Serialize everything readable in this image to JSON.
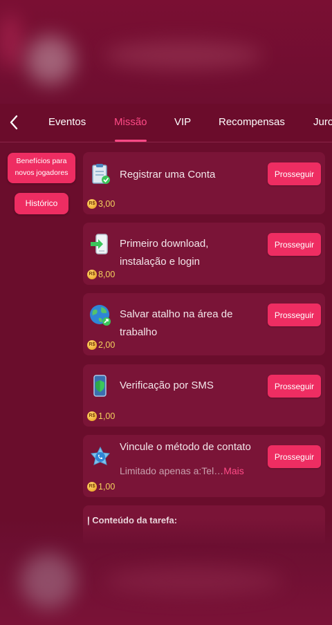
{
  "nav": {
    "back_icon": "chevron-left-icon",
    "tabs": [
      {
        "label": "Eventos",
        "active": false
      },
      {
        "label": "Missão",
        "active": true
      },
      {
        "label": "VIP",
        "active": false
      },
      {
        "label": "Recompensas",
        "active": false
      },
      {
        "label": "Juro",
        "active": false
      }
    ]
  },
  "sidebar": {
    "items": [
      {
        "label_line1": "Benefícios para",
        "label_line2": "novos jogadores"
      },
      {
        "label": "Histórico"
      }
    ]
  },
  "tasks": [
    {
      "title": "Registrar uma Conta",
      "reward": "3,00",
      "button": "Prosseguir",
      "icon": "clipboard-check-icon"
    },
    {
      "title": "Primeiro download, instalação e login",
      "reward": "8,00",
      "button": "Prosseguir",
      "icon": "phone-download-icon"
    },
    {
      "title": "Salvar atalho na área de trabalho",
      "reward": "2,00",
      "button": "Prosseguir",
      "icon": "globe-shortcut-icon"
    },
    {
      "title": "Verificação por SMS",
      "reward": "1,00",
      "button": "Prosseguir",
      "icon": "phone-shield-icon"
    },
    {
      "title": "Vincule o método de contato",
      "subtitle": "Limitado apenas a:Tel…",
      "more": "Mais",
      "reward": "1,00",
      "button": "Prosseguir",
      "icon": "contact-phone-icon"
    }
  ],
  "coin_symbol": "R$",
  "partial_section": "| Conteúdo da tarefa:",
  "colors": {
    "background": "#6a0d2c",
    "card": "#7a1437",
    "accent": "#ee2d62",
    "active_tab": "#ff4a86",
    "reward_text": "#f4d35e"
  }
}
